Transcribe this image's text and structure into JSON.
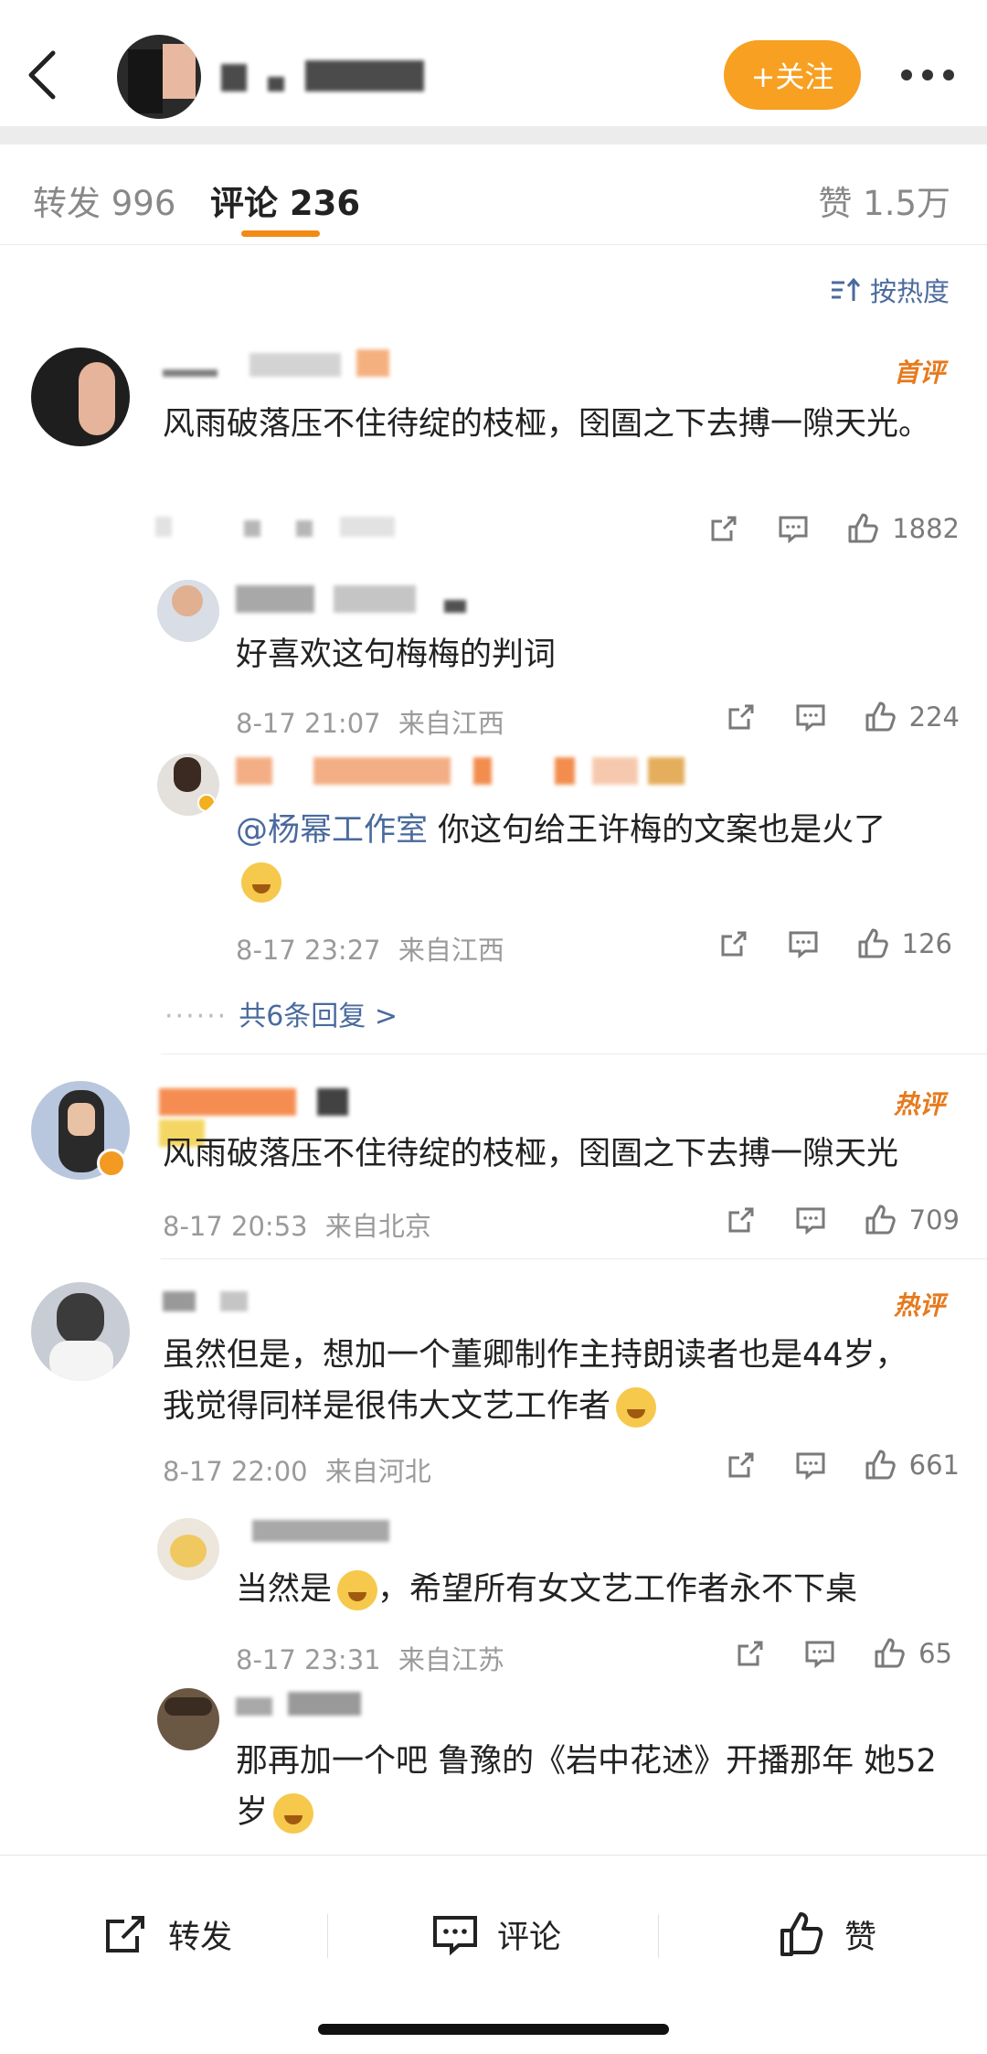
{
  "header": {
    "follow_label": "+关注"
  },
  "tabs": {
    "repost": "转发 996",
    "comment": "评论 236",
    "like": "赞 1.5万"
  },
  "sort_label": "按热度",
  "comments": [
    {
      "badge": "首评",
      "text": "风雨破落压不住待绽的枝桠，囹圄之下去搏一隙天光。",
      "like_count": "1882",
      "replies": [
        {
          "text": "好喜欢这句梅梅的判词",
          "time": "8-17 21:07",
          "location": "来自江西",
          "like_count": "224"
        },
        {
          "mention": "@杨幂工作室",
          "text": " 你这句给王许梅的文案也是火了",
          "time": "8-17 23:27",
          "location": "来自江西",
          "like_count": "126"
        }
      ],
      "more_replies": "共6条回复 >"
    },
    {
      "badge": "热评",
      "text": "风雨破落压不住待绽的枝桠，囹圄之下去搏一隙天光",
      "time": "8-17 20:53",
      "location": "来自北京",
      "like_count": "709"
    },
    {
      "badge": "热评",
      "text": "虽然但是，想加一个董卿制作主持朗读者也是44岁，我觉得同样是很伟大文艺工作者",
      "time": "8-17 22:00",
      "location": "来自河北",
      "like_count": "661",
      "replies": [
        {
          "text_pre": "当然是",
          "text_post": "，希望所有女文艺工作者永不下桌",
          "time": "8-17 23:31",
          "location": "来自江苏",
          "like_count": "65"
        },
        {
          "text": "那再加一个吧 鲁豫的《岩中花述》开播那年 她52岁"
        }
      ]
    }
  ],
  "bottom_bar": {
    "repost": "转发",
    "comment": "评论",
    "like": "赞"
  }
}
